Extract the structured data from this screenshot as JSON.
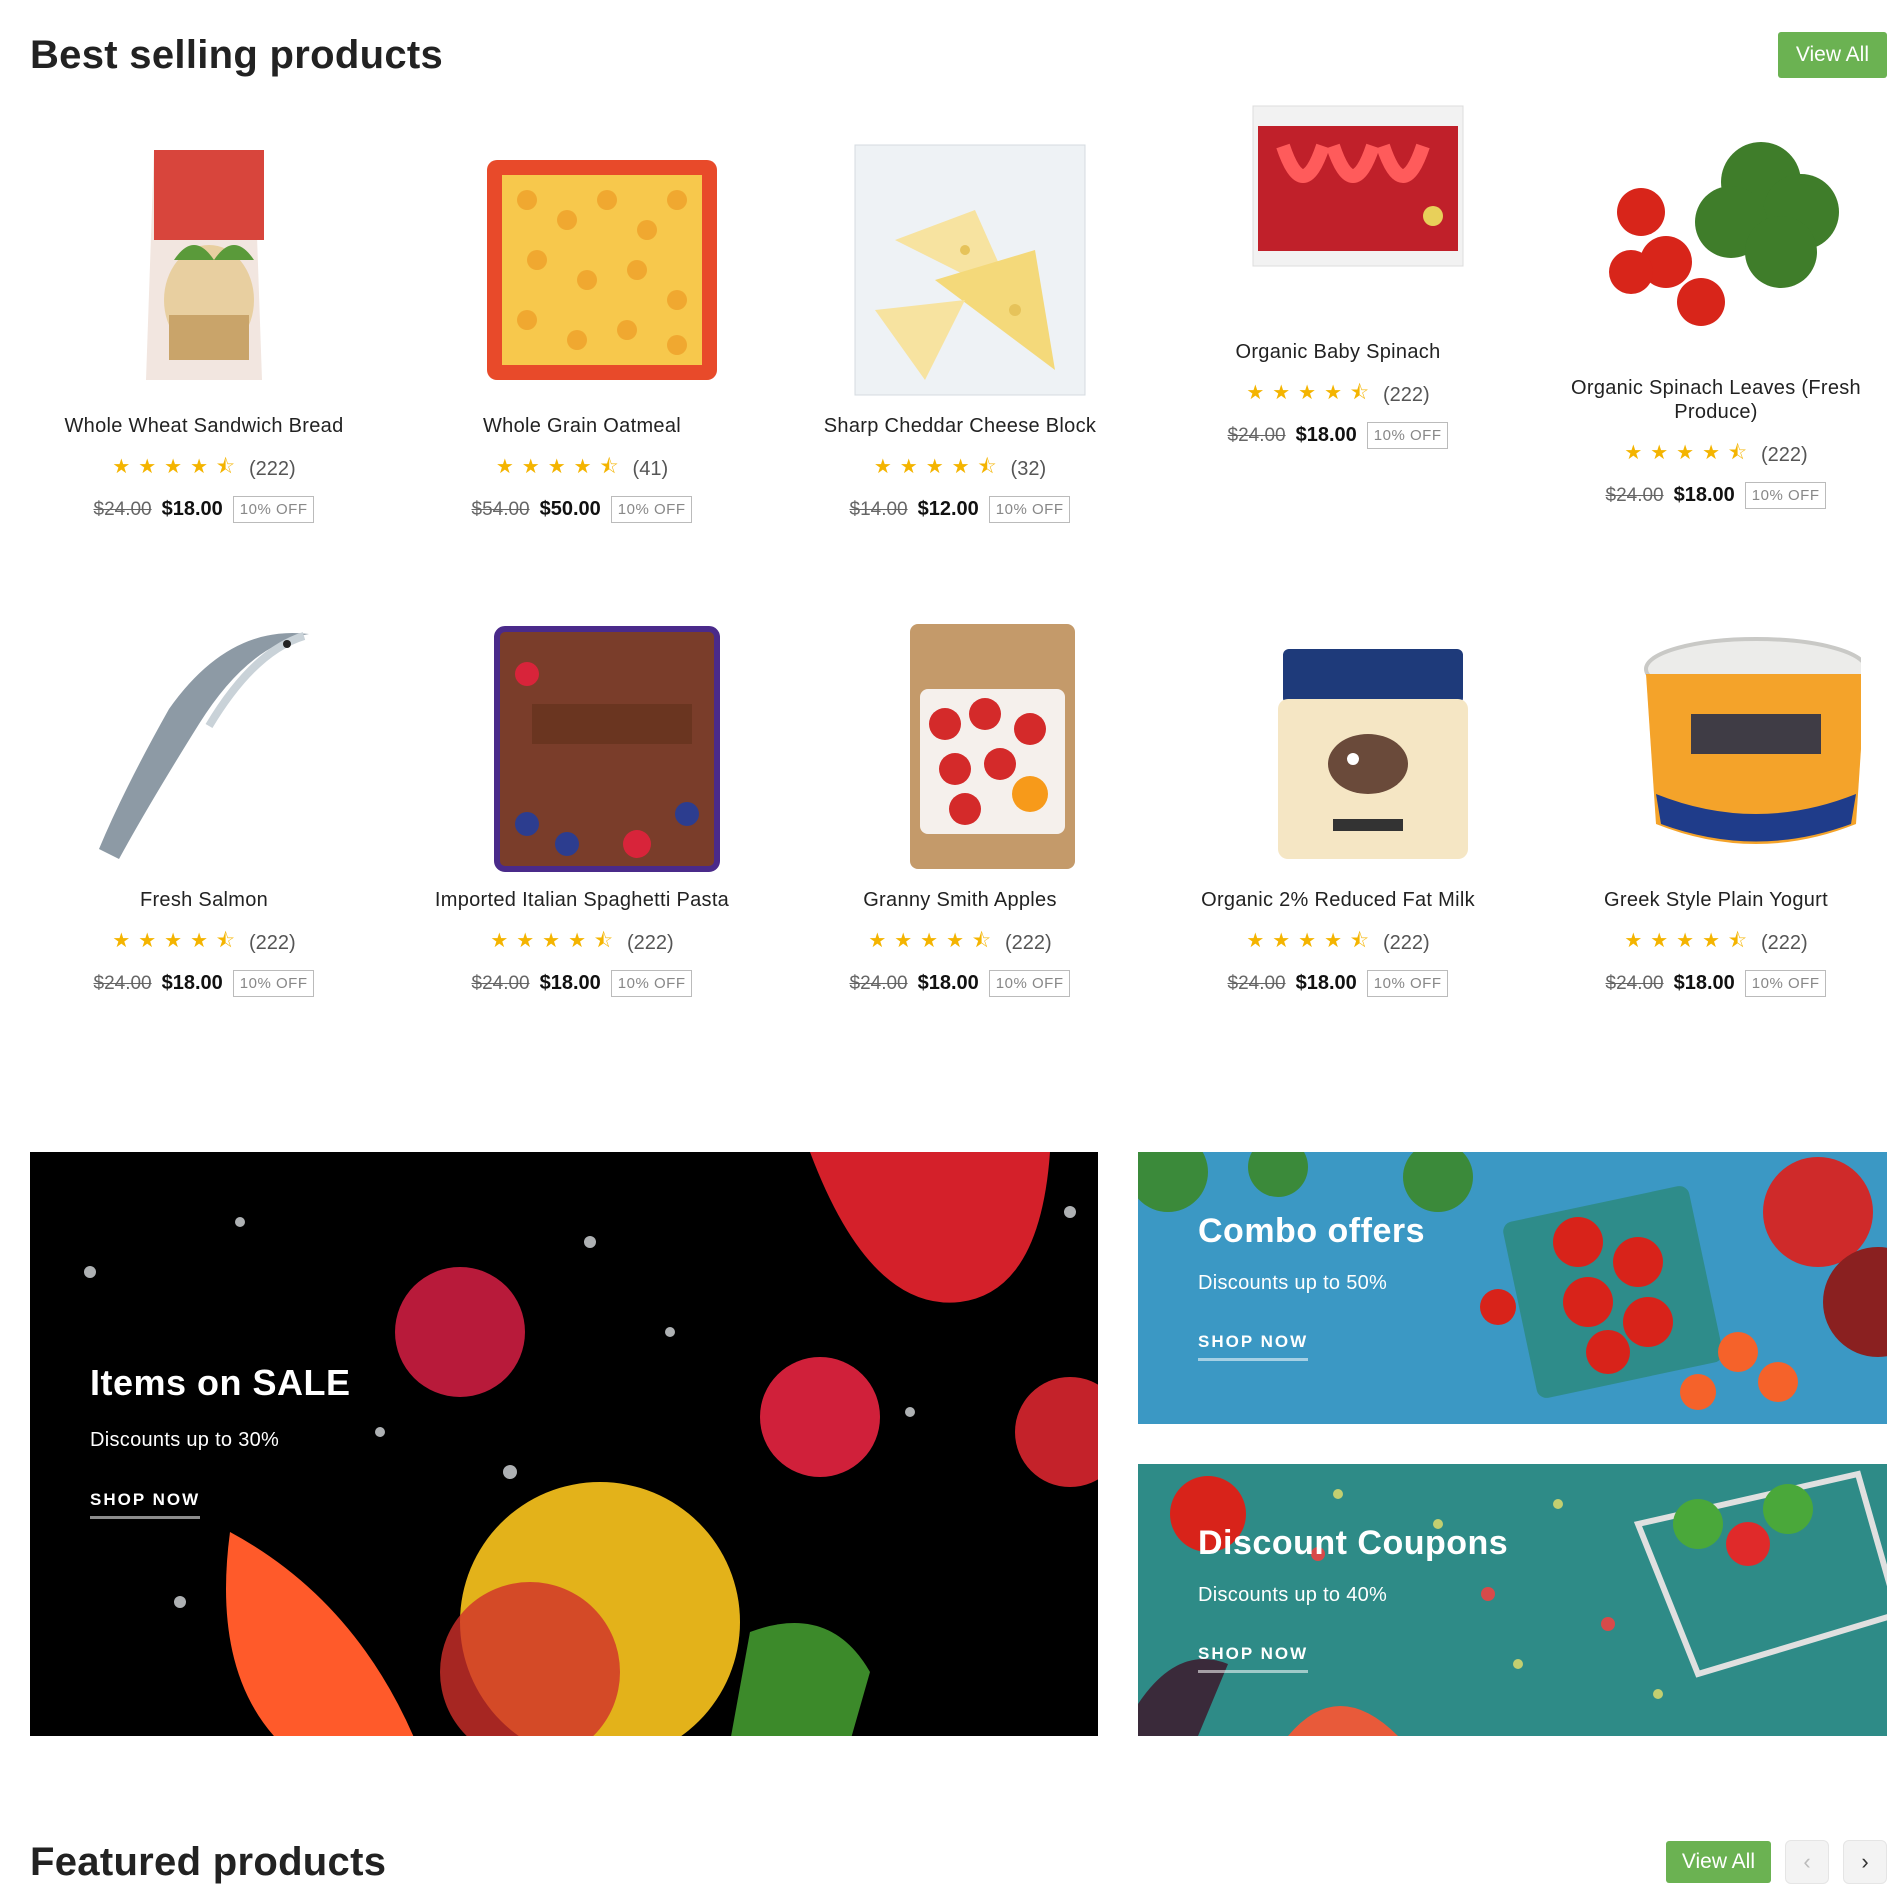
{
  "best_selling": {
    "title": "Best selling products",
    "view_all": "View All",
    "products": [
      {
        "name": "Whole Wheat Sandwich Bread",
        "stars": "★★★★⯪",
        "reviews": "(222)",
        "old_price": "$24.00",
        "price": "$18.00",
        "discount": "10% OFF"
      },
      {
        "name": "Whole Grain Oatmeal",
        "stars": "★★★★⯪",
        "reviews": "(41)",
        "old_price": "$54.00",
        "price": "$50.00",
        "discount": "10% OFF"
      },
      {
        "name": "Sharp Cheddar Cheese Block",
        "stars": "★★★★⯪",
        "reviews": "(32)",
        "old_price": "$14.00",
        "price": "$12.00",
        "discount": "10% OFF"
      },
      {
        "name": "Organic Baby Spinach",
        "stars": "★★★★⯪",
        "reviews": "(222)",
        "old_price": "$24.00",
        "price": "$18.00",
        "discount": "10% OFF"
      },
      {
        "name": "Organic Spinach Leaves (Fresh Produce)",
        "stars": "★★★★⯪",
        "reviews": "(222)",
        "old_price": "$24.00",
        "price": "$18.00",
        "discount": "10% OFF"
      },
      {
        "name": "Fresh Salmon",
        "stars": "★★★★⯪",
        "reviews": "(222)",
        "old_price": "$24.00",
        "price": "$18.00",
        "discount": "10% OFF"
      },
      {
        "name": "Imported Italian Spaghetti Pasta",
        "stars": "★★★★⯪",
        "reviews": "(222)",
        "old_price": "$24.00",
        "price": "$18.00",
        "discount": "10% OFF"
      },
      {
        "name": "Granny Smith Apples",
        "stars": "★★★★⯪",
        "reviews": "(222)",
        "old_price": "$24.00",
        "price": "$18.00",
        "discount": "10% OFF"
      },
      {
        "name": "Organic 2% Reduced Fat Milk",
        "stars": "★★★★⯪",
        "reviews": "(222)",
        "old_price": "$24.00",
        "price": "$18.00",
        "discount": "10% OFF"
      },
      {
        "name": "Greek Style Plain Yogurt",
        "stars": "★★★★⯪",
        "reviews": "(222)",
        "old_price": "$24.00",
        "price": "$18.00",
        "discount": "10% OFF"
      }
    ]
  },
  "banners": {
    "sale": {
      "title": "Items on SALE",
      "subtitle": "Discounts up to 30%",
      "cta": "SHOP NOW"
    },
    "combo": {
      "title": "Combo offers",
      "subtitle": "Discounts up to 50%",
      "cta": "SHOP NOW"
    },
    "coupons": {
      "title": "Discount Coupons",
      "subtitle": "Discounts up to 40%",
      "cta": "SHOP NOW"
    }
  },
  "featured": {
    "title": "Featured products",
    "view_all": "View All",
    "prev_icon": "chevron-left-icon",
    "next_icon": "chevron-right-icon"
  },
  "colors": {
    "accent": "#6bb252",
    "star": "#f4b400"
  }
}
